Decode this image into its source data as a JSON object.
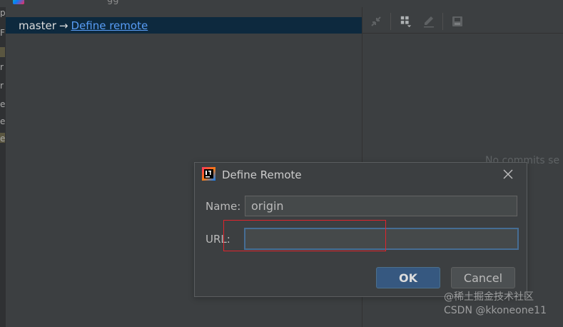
{
  "window": {
    "title_fragment": "gg"
  },
  "left_strip": {
    "glyphs": [
      "p",
      "F",
      "r",
      "r",
      "e",
      "e",
      "e",
      "e"
    ]
  },
  "branch_bar": {
    "branch": "master",
    "arrow": "→",
    "remote_link": "Define remote"
  },
  "log_panel": {
    "empty_text": "No commits se"
  },
  "dialog": {
    "title": "Define Remote",
    "name_label": "Name:",
    "name_value": "origin",
    "url_label": "URL:",
    "url_value": "",
    "ok_label": "OK",
    "cancel_label": "Cancel"
  },
  "watermark": "@稀土掘金技术社区\nCSDN @kkoneone11",
  "colors": {
    "background": "#3c3f41",
    "branch_bar": "#0d293e",
    "link": "#589df6",
    "ok_button": "#365880",
    "focus_border": "#466d94",
    "annotation_red": "#e0242c"
  },
  "icons": {
    "toolbar": [
      "collapse-icon",
      "group-icon",
      "edit-icon",
      "save-icon"
    ],
    "dialog": [
      "intellij-logo-icon",
      "close-icon"
    ]
  }
}
